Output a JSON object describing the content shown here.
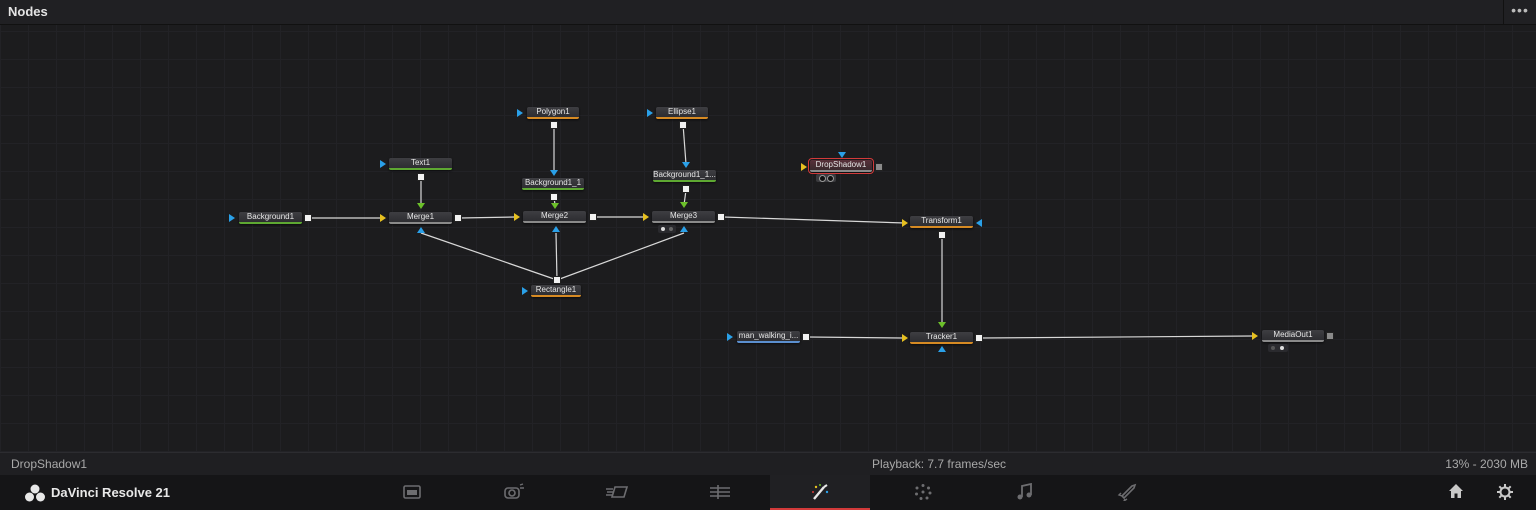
{
  "panel": {
    "title": "Nodes"
  },
  "nodes": {
    "background1": "Background1",
    "text1": "Text1",
    "merge1": "Merge1",
    "polygon1": "Polygon1",
    "background1_1": "Background1_1",
    "merge2": "Merge2",
    "ellipse1": "Ellipse1",
    "background1_1_trunc": "Background1_1...",
    "merge3": "Merge3",
    "dropshadow1": "DropShadow1",
    "transform1": "Transform1",
    "rectangle1": "Rectangle1",
    "man_walking": "man_walking_i...",
    "tracker1": "Tracker1",
    "mediaout1": "MediaOut1"
  },
  "status": {
    "selected_node": "DropShadow1",
    "playback": "Playback: 7.7 frames/sec",
    "memory": "13% - 2030 MB"
  },
  "app": {
    "name": "DaVinci Resolve 21"
  },
  "pages": [
    {
      "name": "media-page",
      "active": false
    },
    {
      "name": "cut-page",
      "active": false
    },
    {
      "name": "edit-page",
      "active": false
    },
    {
      "name": "fusion-page",
      "active": true
    },
    {
      "name": "color-page",
      "active": false
    },
    {
      "name": "fairlight-page",
      "active": false
    },
    {
      "name": "deliver-page",
      "active": false
    }
  ],
  "colors": {
    "accent": "#d23a3a",
    "mask_port": "#2aa0e8",
    "fg_port": "#6cc02a",
    "bg_port": "#e6c020"
  }
}
